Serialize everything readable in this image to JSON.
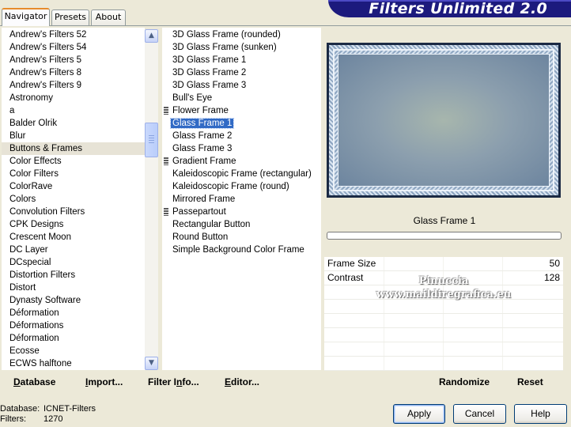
{
  "app": {
    "title": "Filters Unlimited 2.0"
  },
  "tabs": [
    "Navigator",
    "Presets",
    "About"
  ],
  "categories": [
    "Andrew's Filters 52",
    "Andrew's Filters 54",
    "Andrew's Filters 5",
    "Andrew's Filters 8",
    "Andrew's Filters 9",
    "Astronomy",
    "a",
    "Balder Olrik",
    "Blur",
    "Buttons & Frames",
    "Color Effects",
    "Color Filters",
    "ColorRave",
    "Colors",
    "Convolution Filters",
    "CPK Designs",
    "Crescent Moon",
    "DC Layer",
    "DCspecial",
    "Distortion Filters",
    "Distort",
    "Dynasty Software",
    "Déformation",
    "Déformations",
    "Déformation",
    "Ecosse",
    "ECWS halftone"
  ],
  "selected_category": "Buttons & Frames",
  "filters": [
    {
      "name": "3D Glass Frame (rounded)",
      "marker": false
    },
    {
      "name": "3D Glass Frame (sunken)",
      "marker": false
    },
    {
      "name": "3D Glass Frame 1",
      "marker": false
    },
    {
      "name": "3D Glass Frame 2",
      "marker": false
    },
    {
      "name": "3D Glass Frame 3",
      "marker": false
    },
    {
      "name": "Bull's Eye",
      "marker": false
    },
    {
      "name": "Flower Frame",
      "marker": true
    },
    {
      "name": "Glass Frame 1",
      "marker": false
    },
    {
      "name": "Glass Frame 2",
      "marker": false
    },
    {
      "name": "Glass Frame 3",
      "marker": false
    },
    {
      "name": "Gradient Frame",
      "marker": true
    },
    {
      "name": "Kaleidoscopic Frame (rectangular)",
      "marker": false
    },
    {
      "name": "Kaleidoscopic Frame (round)",
      "marker": false
    },
    {
      "name": "Mirrored Frame",
      "marker": false
    },
    {
      "name": "Passepartout",
      "marker": true
    },
    {
      "name": "Rectangular Button",
      "marker": false
    },
    {
      "name": "Round Button",
      "marker": false
    },
    {
      "name": "Simple Background Color Frame",
      "marker": false
    }
  ],
  "selected_filter": "Glass Frame 1",
  "scrollbar": {
    "up": "▲",
    "down": "▼"
  },
  "preview": {
    "filter_name": "Glass Frame 1"
  },
  "parameters": [
    {
      "name": "Frame Size",
      "value": "50"
    },
    {
      "name": "Contrast",
      "value": "128"
    }
  ],
  "watermark": {
    "line1": "Pinuccia",
    "line2": "www.maildiregrafica.eu"
  },
  "toolbar": {
    "database_label": "Database",
    "import_label": "Import...",
    "filter_info_label": "Filter Info...",
    "editor_label": "Editor...",
    "randomize_label": "Randomize",
    "reset_label": "Reset"
  },
  "status": {
    "database_label": "Database:",
    "database_value": "ICNET-Filters",
    "filters_label": "Filters:",
    "filters_value": "1270"
  },
  "buttons": {
    "apply": "Apply",
    "cancel": "Cancel",
    "help": "Help"
  },
  "colors": {
    "banner": "#1c1a7d",
    "selection": "#316ac5",
    "tab_accent": "#e68b2c"
  }
}
